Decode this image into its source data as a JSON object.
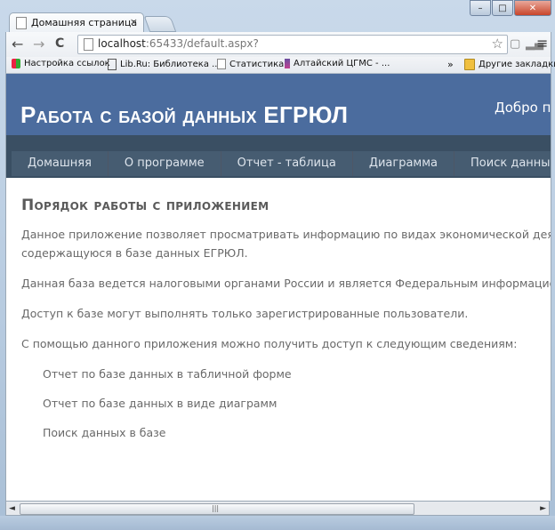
{
  "browser": {
    "tab_title": "Домашняя страница",
    "tab_close": "×",
    "window_controls": {
      "minimize": "–",
      "maximize": "□",
      "close": "✕"
    },
    "nav": {
      "back": "←",
      "forward": "→",
      "reload": "C"
    },
    "address": {
      "host": "localhost",
      "rest": ":65433/default.aspx?"
    },
    "star": "☆",
    "menu": "≡",
    "bookmarks": [
      {
        "label": "Настройка ссылок",
        "icon": "windows-icon"
      },
      {
        "label": "Lib.Ru: Библиотека ...",
        "icon": "lib-icon"
      },
      {
        "label": "Статистика",
        "icon": "page-icon"
      },
      {
        "label": "Алтайский ЦГМС - ...",
        "icon": "altai-icon"
      }
    ],
    "overflow": "»",
    "other_bookmarks": "Другие закладки"
  },
  "site": {
    "title": "Работа с базой данных ЕГРЮЛ",
    "welcome": "Добро по",
    "menu": [
      {
        "label": "Домашняя"
      },
      {
        "label": "О программе"
      },
      {
        "label": "Отчет - таблица"
      },
      {
        "label": "Диаграмма"
      },
      {
        "label": "Поиск данных"
      }
    ]
  },
  "content": {
    "heading": "Порядок работы с приложением",
    "p1_line1": "Данное приложение позволяет просматривать информацию по видах экономической деятельности юр",
    "p1_line2": "содержащуюся в базе данных ЕГРЮЛ.",
    "p2": "Данная база ведется налоговыми органами России и является Федеральным информационным ресурс",
    "p3": "Доступ к базе могут выполнять только зарегистрированные пользователи.",
    "p4": "С помощью данного приложения можно получить доступ к следующим сведениям:",
    "items": [
      {
        "label": "Отчет по базе данных в табличной форме"
      },
      {
        "label": "Отчет по базе данных в виде диаграмм"
      },
      {
        "label": "Поиск данных в базе"
      }
    ]
  },
  "scrollbar": {
    "left": "◄",
    "right": "►",
    "grip": "|||"
  }
}
